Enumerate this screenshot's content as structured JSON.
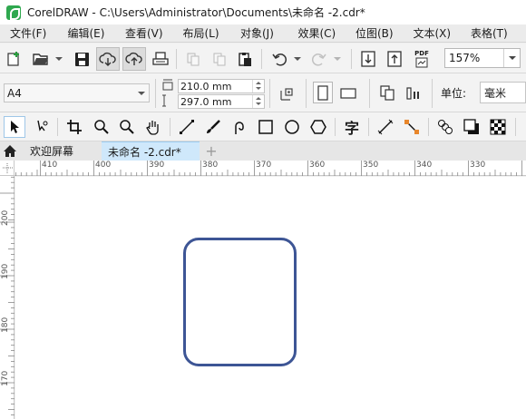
{
  "window": {
    "title": "CorelDRAW - C:\\Users\\Administrator\\Documents\\未命名 -2.cdr*"
  },
  "menu": [
    {
      "label": "文件(F)"
    },
    {
      "label": "编辑(E)"
    },
    {
      "label": "查看(V)"
    },
    {
      "label": "布局(L)"
    },
    {
      "label": "对象(J)"
    },
    {
      "label": "效果(C)"
    },
    {
      "label": "位图(B)"
    },
    {
      "label": "文本(X)"
    },
    {
      "label": "表格(T)"
    }
  ],
  "standard_toolbar": {
    "icons": [
      "new-document-icon",
      "open-icon",
      "save-icon",
      "cloud-download-icon",
      "cloud-upload-icon",
      "print-icon",
      "cut-icon",
      "copy-icon",
      "paste-icon",
      "undo-icon",
      "redo-icon",
      "import-icon",
      "export-icon",
      "publish-pdf-icon"
    ],
    "pdf_label": "PDF",
    "zoom_value": "157%"
  },
  "property_bar": {
    "page_size": "A4",
    "width": "210.0 mm",
    "height": "297.0 mm",
    "units_label": "单位:",
    "units_value": "毫米"
  },
  "toolbox": {
    "text_tool_glyph": "字",
    "icons": [
      "pick-tool-icon",
      "shape-tool-icon",
      "crop-tool-icon",
      "zoom-tool-icon",
      "pan-tool-icon",
      "freehand-tool-icon",
      "artistic-media-icon",
      "pen-tool-icon",
      "rectangle-tool-icon",
      "ellipse-tool-icon",
      "polygon-tool-icon",
      "text-tool-icon",
      "dimension-tool-icon",
      "connector-tool-icon",
      "blend-tool-icon",
      "drop-shadow-icon",
      "transparency-icon"
    ]
  },
  "tabs": {
    "welcome": "欢迎屏幕",
    "document": "未命名 -2.cdr*",
    "add": "+"
  },
  "ruler": {
    "h_ticks": [
      "410",
      "400",
      "390",
      "380",
      "370",
      "360",
      "350",
      "340",
      "330"
    ],
    "v_ticks": [
      "200",
      "190",
      "180",
      "170"
    ]
  },
  "colors": {
    "shape_outline": "#3d5595",
    "active_tab": "#cfe8fb"
  }
}
